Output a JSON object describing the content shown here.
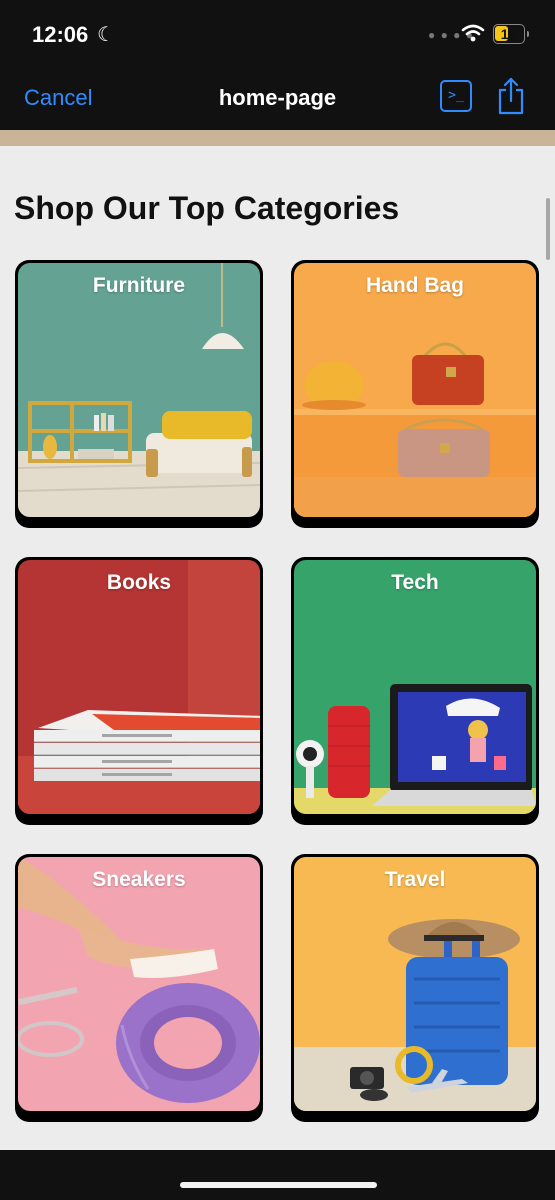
{
  "status_bar": {
    "time": "12:06",
    "battery": "18",
    "icons": [
      "moon-icon",
      "signal-dots-icon",
      "wifi-icon",
      "battery-icon"
    ]
  },
  "nav": {
    "cancel_label": "Cancel",
    "title": "home-page",
    "terminal_label": ">_",
    "icons": [
      "terminal-icon",
      "share-icon"
    ],
    "accent": "#2f8cff"
  },
  "page": {
    "heading": "Shop Our Top Categories",
    "categories": [
      {
        "label": "Furniture",
        "color": "#5e9f8f"
      },
      {
        "label": "Hand Bag",
        "color": "#f6a94a"
      },
      {
        "label": "Books",
        "color": "#b83535"
      },
      {
        "label": "Tech",
        "color": "#34a66a"
      },
      {
        "label": "Sneakers",
        "color": "#f0a3b0"
      },
      {
        "label": "Travel",
        "color": "#f9bb52"
      }
    ]
  }
}
